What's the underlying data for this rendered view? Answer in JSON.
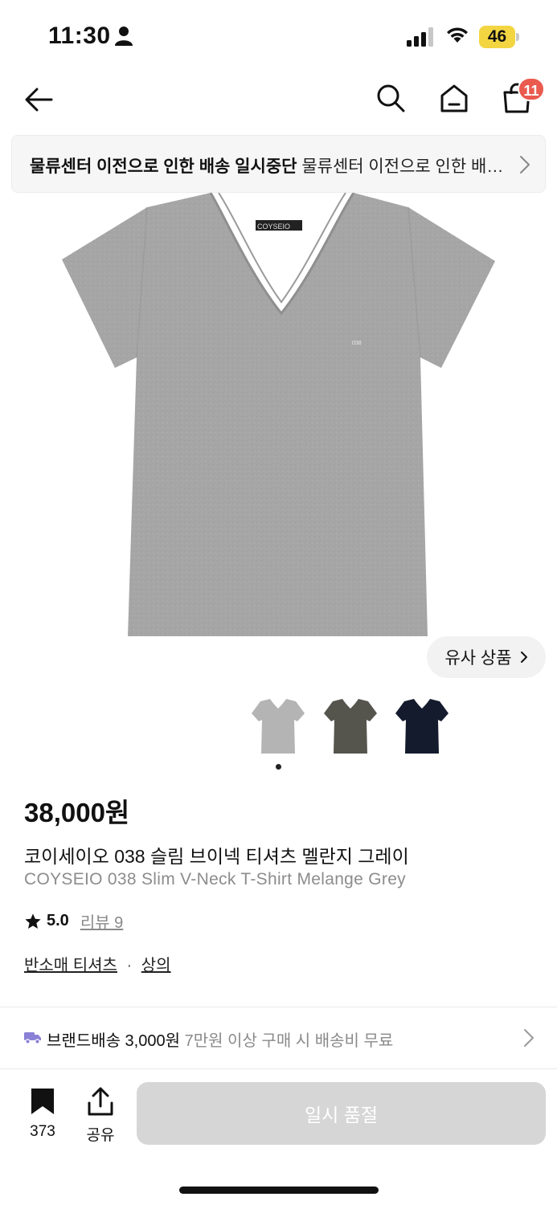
{
  "status_bar": {
    "time": "11:30",
    "battery_level": "46"
  },
  "header": {
    "cart_count": "11"
  },
  "notice": {
    "title": "물류센터 이전으로 인한 배송 일시중단",
    "body": "물류센터 이전으로 인한 배송 일시중단 안내"
  },
  "similar_button": "유사 상품",
  "thumbnails": [
    {
      "color_name": "grey",
      "color": "#b4b4b4"
    },
    {
      "color_name": "charcoal",
      "color": "#55544d"
    },
    {
      "color_name": "navy",
      "color": "#141b2d"
    }
  ],
  "product": {
    "price": "38,000원",
    "name_ko": "코이세이오 038 슬림 브이넥 티셔츠 멜란지 그레이",
    "name_en": "COYSEIO 038 Slim V-Neck T-Shirt Melange Grey",
    "rating": "5.0",
    "reviews_label": "리뷰 9",
    "category_1": "반소매 티셔츠",
    "category_sep": "·",
    "category_2": "상의",
    "neck_label": "COYSEIO",
    "chest_print": "038"
  },
  "shipping": {
    "label": "브랜드배송 3,000원",
    "sub": "7만원 이상 구매 시 배송비 무료"
  },
  "bottom_bar": {
    "bookmark_count": "373",
    "share_label": "공유",
    "cta_label": "일시 품절"
  },
  "colors": {
    "accent_badge": "#ea5a4f",
    "battery": "#f3d542",
    "truck": "#8a80d6",
    "disabled_cta": "#d6d6d6"
  }
}
